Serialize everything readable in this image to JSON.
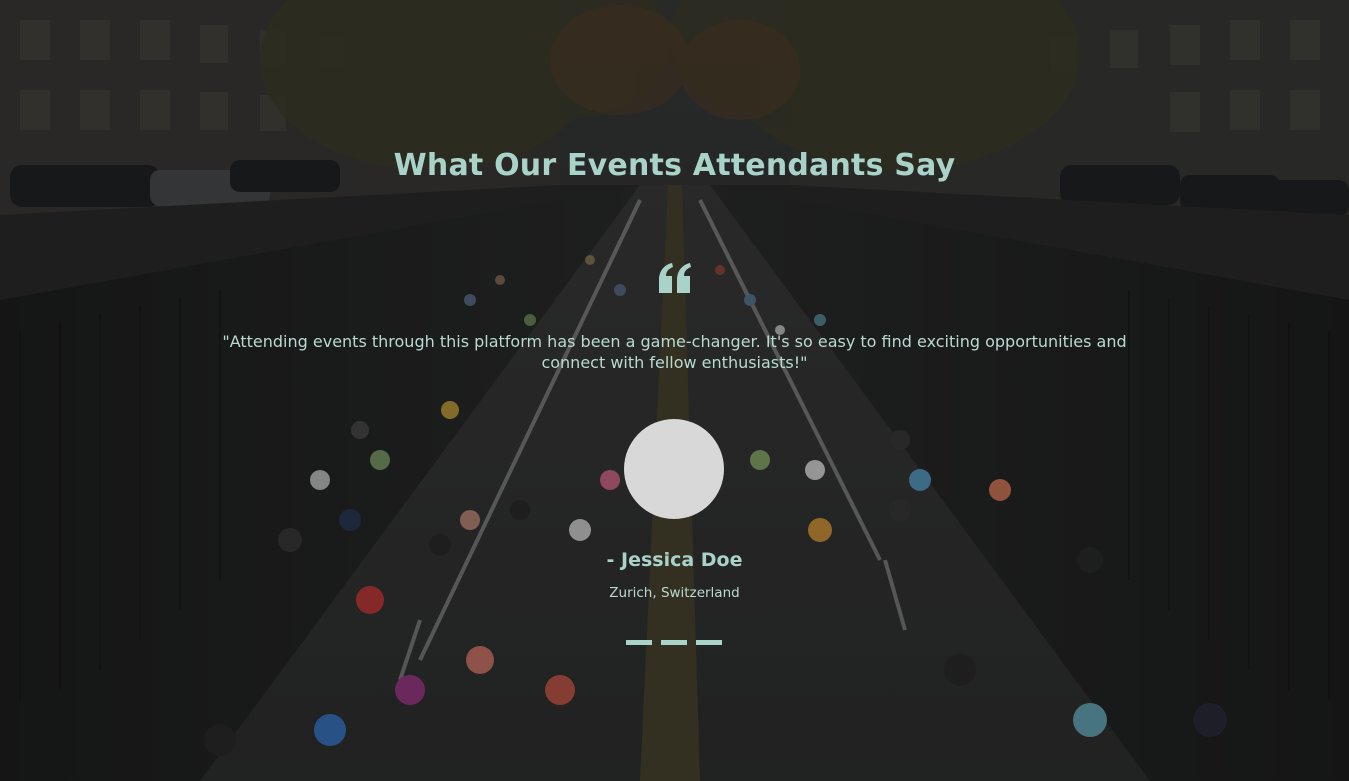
{
  "section": {
    "title": "What Our Events Attendants Say",
    "accent_color": "#a9d3c9"
  },
  "testimonial": {
    "quote_icon": "quote-icon",
    "text": "\"Attending events through this platform has been a game-changer. It's so easy to find exciting opportunities and connect with fellow enthusiasts!\"",
    "author_name": "- Jessica Doe",
    "author_location": "Zurich, Switzerland"
  },
  "carousel": {
    "slides": [
      {
        "label": ""
      },
      {
        "label": ""
      },
      {
        "label": ""
      }
    ],
    "active_index": 0
  }
}
